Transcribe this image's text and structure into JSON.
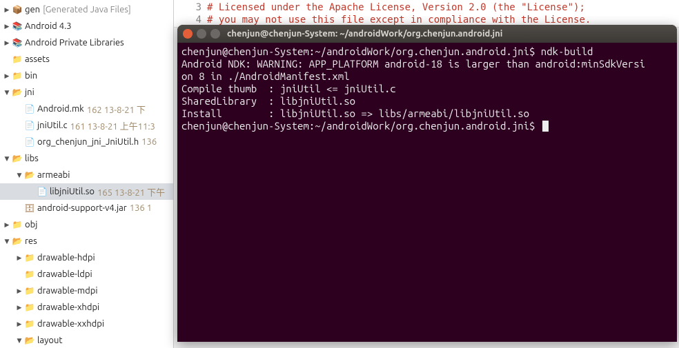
{
  "tree": [
    {
      "depth": 0,
      "arrow": "collapsed",
      "icon": "pkg",
      "label": "gen",
      "extra": "[Generated Java Files]",
      "extraClass": "generated"
    },
    {
      "depth": 0,
      "arrow": "collapsed",
      "icon": "lib",
      "label": "Android 4.3"
    },
    {
      "depth": 0,
      "arrow": "collapsed",
      "icon": "lib",
      "label": "Android Private Libraries"
    },
    {
      "depth": 0,
      "arrow": "none",
      "icon": "folder",
      "label": "assets"
    },
    {
      "depth": 0,
      "arrow": "collapsed",
      "icon": "folder",
      "label": "bin"
    },
    {
      "depth": 0,
      "arrow": "expanded",
      "icon": "folder-open",
      "label": "jni"
    },
    {
      "depth": 1,
      "arrow": "none",
      "icon": "mk",
      "label": "Android.mk",
      "meta": "162  13-8-21 下"
    },
    {
      "depth": 1,
      "arrow": "none",
      "icon": "c",
      "label": "jniUtil.c",
      "meta": "161  13-8-21 上午11:3"
    },
    {
      "depth": 1,
      "arrow": "none",
      "icon": "h",
      "label": "org_chenjun_jni_JniUtil.h",
      "meta": "136"
    },
    {
      "depth": 0,
      "arrow": "expanded",
      "icon": "folder-open",
      "label": "libs"
    },
    {
      "depth": 1,
      "arrow": "expanded",
      "icon": "folder-open",
      "label": "armeabi"
    },
    {
      "depth": 2,
      "arrow": "none",
      "icon": "file",
      "label": "libjniUtil.so",
      "meta": "165  13-8-21 下午",
      "selected": true
    },
    {
      "depth": 1,
      "arrow": "none",
      "icon": "jar",
      "label": "android-support-v4.jar",
      "meta": "136  1"
    },
    {
      "depth": 0,
      "arrow": "collapsed",
      "icon": "folder",
      "label": "obj"
    },
    {
      "depth": 0,
      "arrow": "expanded",
      "icon": "folder-open",
      "label": "res"
    },
    {
      "depth": 1,
      "arrow": "collapsed",
      "icon": "folder",
      "label": "drawable-hdpi"
    },
    {
      "depth": 1,
      "arrow": "none",
      "icon": "folder",
      "label": "drawable-ldpi"
    },
    {
      "depth": 1,
      "arrow": "collapsed",
      "icon": "folder",
      "label": "drawable-mdpi"
    },
    {
      "depth": 1,
      "arrow": "collapsed",
      "icon": "folder",
      "label": "drawable-xhdpi"
    },
    {
      "depth": 1,
      "arrow": "collapsed",
      "icon": "folder",
      "label": "drawable-xxhdpi"
    },
    {
      "depth": 1,
      "arrow": "expanded",
      "icon": "folder-open",
      "label": "layout"
    }
  ],
  "editor": {
    "lines": [
      {
        "num": "3",
        "text": "# Licensed under the Apache License, Version 2.0 (the \"License\");"
      },
      {
        "num": "4",
        "text": "# you may not use this file except in compliance with the License."
      }
    ]
  },
  "terminal": {
    "title": "chenjun@chenjun-System: ~/androidWork/org.chenjun.android.jni",
    "lines": [
      "chenjun@chenjun-System:~/androidWork/org.chenjun.android.jni$ ndk-build",
      "Android NDK: WARNING: APP_PLATFORM android-18 is larger than android:minSdkVersi",
      "on 8 in ./AndroidManifest.xml    ",
      "Compile thumb  : jniUtil <= jniUtil.c",
      "SharedLibrary  : libjniUtil.so",
      "Install        : libjniUtil.so => libs/armeabi/libjniUtil.so",
      "chenjun@chenjun-System:~/androidWork/org.chenjun.android.jni$ "
    ]
  },
  "icons": {
    "pkg": "📦",
    "lib": "📚",
    "folder": "📁",
    "folder-open": "📂",
    "mk": "📄",
    "c": "📄",
    "h": "📄",
    "file": "📄",
    "jar": "🗄"
  }
}
